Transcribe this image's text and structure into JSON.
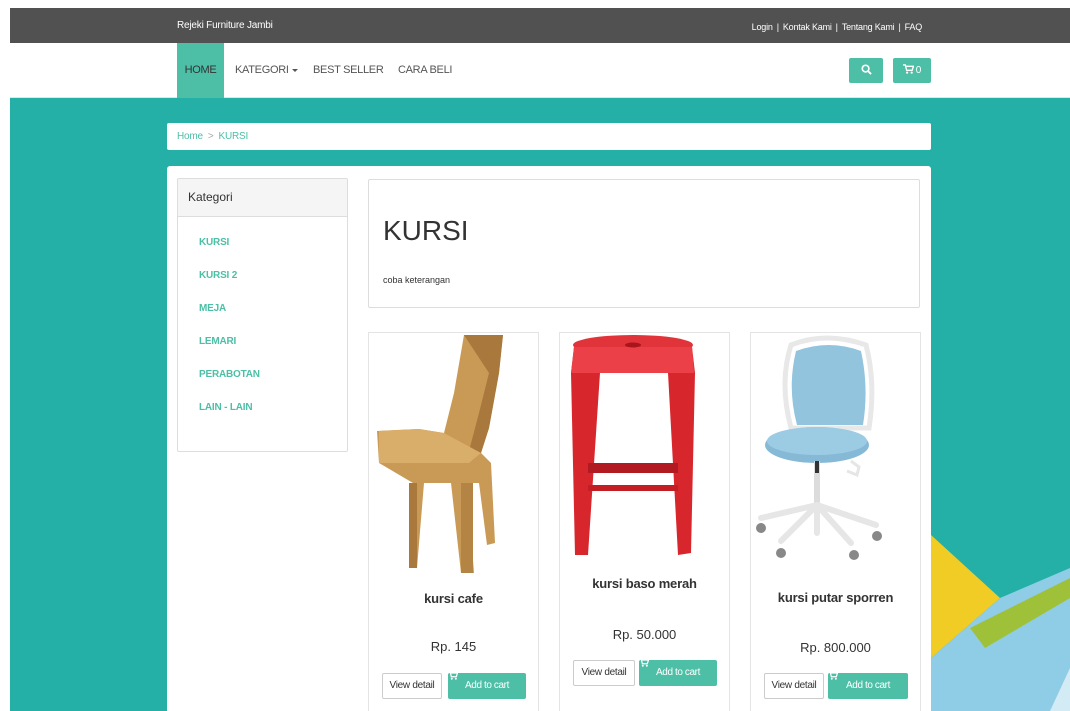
{
  "topbar": {
    "brand": "Rejeki Furniture Jambi",
    "links": [
      "Login",
      "Kontak Kami",
      "Tentang Kami",
      "FAQ"
    ]
  },
  "nav": {
    "items": [
      "HOME",
      "KATEGORI",
      "BEST SELLER",
      "CARA BELI"
    ],
    "active": "HOME",
    "cart_count": "0"
  },
  "breadcrumb": {
    "home": "Home",
    "separator": ">",
    "current": "KURSI"
  },
  "sidebar": {
    "title": "Kategori",
    "items": [
      "KURSI",
      "KURSI 2",
      "MEJA",
      "LEMARI",
      "PERABOTAN",
      "LAIN - LAIN"
    ]
  },
  "category": {
    "title": "KURSI",
    "description": "coba keterangan"
  },
  "products": [
    {
      "name": "kursi cafe",
      "price": "Rp. 145",
      "view_label": "View detail",
      "cart_label": "Add to cart"
    },
    {
      "name": "kursi baso merah",
      "price": "Rp. 50.000",
      "view_label": "View detail",
      "cart_label": "Add to cart"
    },
    {
      "name": "kursi putar sporren",
      "price": "Rp. 800.000",
      "view_label": "View detail",
      "cart_label": "Add to cart"
    }
  ],
  "colors": {
    "accent": "#4cbfa6",
    "background": "#24b0a6",
    "topbar": "#515151"
  }
}
